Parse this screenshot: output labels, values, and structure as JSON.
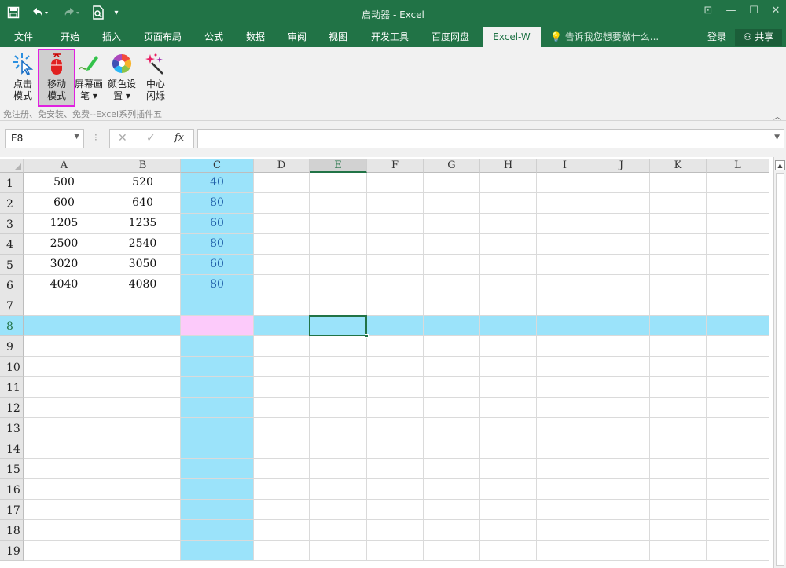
{
  "window": {
    "title": "启动器 - Excel",
    "controls": [
      "ribbon-display-icon",
      "minimize-icon",
      "maximize-icon",
      "close-icon"
    ]
  },
  "quick_access": {
    "save_icon": "save-icon",
    "undo_icon": "undo-icon",
    "redo_icon": "redo-icon",
    "preview_icon": "print-preview-icon",
    "customize_icon": "customize-icon"
  },
  "tabs": [
    {
      "label": "文件",
      "active": false
    },
    {
      "label": "开始",
      "active": false
    },
    {
      "label": "插入",
      "active": false
    },
    {
      "label": "页面布局",
      "active": false
    },
    {
      "label": "公式",
      "active": false
    },
    {
      "label": "数据",
      "active": false
    },
    {
      "label": "审阅",
      "active": false
    },
    {
      "label": "视图",
      "active": false
    },
    {
      "label": "开发工具",
      "active": false
    },
    {
      "label": "百度网盘",
      "active": false
    },
    {
      "label": "Excel-W",
      "active": true
    }
  ],
  "tell_me": "告诉我您想要做什么...",
  "login": "登录",
  "share": "共享",
  "ribbon": {
    "buttons": [
      {
        "line1": "点击",
        "line2": "模式",
        "icon": "click-cursor-icon",
        "selected": false
      },
      {
        "line1": "移动",
        "line2": "模式",
        "icon": "mouse-icon",
        "selected": true
      },
      {
        "line1": "屏幕画",
        "line2": "笔 ▾",
        "icon": "pen-icon",
        "selected": false
      },
      {
        "line1": "颜色设",
        "line2": "置 ▾",
        "icon": "color-wheel-icon",
        "selected": false
      },
      {
        "line1": "中心",
        "line2": "闪烁",
        "icon": "sparkle-wand-icon",
        "selected": false
      }
    ],
    "group_label": "免注册、免安装、免费--Excel系列插件五"
  },
  "formula_bar": {
    "name_box": "E8",
    "cancel": "✕",
    "enter": "✓",
    "fx": "fx",
    "formula": ""
  },
  "sheet": {
    "columns": [
      "A",
      "B",
      "C",
      "D",
      "E",
      "F",
      "G",
      "H",
      "I",
      "J",
      "K",
      "L"
    ],
    "rows": [
      "1",
      "2",
      "3",
      "4",
      "5",
      "6",
      "7",
      "8",
      "9",
      "10",
      "11",
      "12",
      "13",
      "14",
      "15",
      "16",
      "17",
      "18",
      "19"
    ],
    "data": [
      [
        "500",
        "520",
        "40"
      ],
      [
        "600",
        "640",
        "80"
      ],
      [
        "1205",
        "1235",
        "60"
      ],
      [
        "2500",
        "2540",
        "80"
      ],
      [
        "3020",
        "3050",
        "60"
      ],
      [
        "4040",
        "4080",
        "80"
      ]
    ],
    "active_cell": "E8",
    "highlight_row": 8,
    "highlight_column": "C",
    "colors": {
      "highlight": "#9be3fa",
      "crosshair": "#fccafa",
      "col_c_text": "#1f5fa8",
      "accent": "#217346"
    }
  }
}
